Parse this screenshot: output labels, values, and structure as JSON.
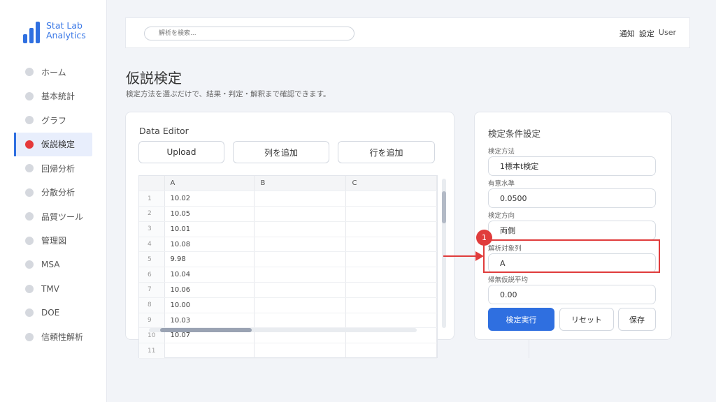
{
  "app": {
    "name": "Stat Lab Analytics"
  },
  "sidebar": {
    "items": [
      {
        "label": "ホーム"
      },
      {
        "label": "基本統計"
      },
      {
        "label": "グラフ"
      },
      {
        "label": "仮説検定",
        "active": true
      },
      {
        "label": "回帰分析"
      },
      {
        "label": "分散分析"
      },
      {
        "label": "品質ツール"
      },
      {
        "label": "管理図"
      },
      {
        "label": "MSA"
      },
      {
        "label": "TMV"
      },
      {
        "label": "DOE"
      },
      {
        "label": "信頼性解析"
      }
    ]
  },
  "topbar": {
    "search_placeholder": "解析を検索...",
    "notifications": "通知",
    "settings": "設定",
    "user": "User"
  },
  "page": {
    "title": "仮説検定",
    "subtitle": "検定方法を選ぶだけで、結果・判定・解釈まで確認できます。"
  },
  "editor": {
    "title": "Data Editor",
    "upload": "Upload",
    "add_column": "列を追加",
    "add_row": "行を追加",
    "columns": [
      "A",
      "B",
      "C"
    ],
    "rows": [
      {
        "n": "1",
        "a": "10.02"
      },
      {
        "n": "2",
        "a": "10.05"
      },
      {
        "n": "3",
        "a": "10.01"
      },
      {
        "n": "4",
        "a": "10.08"
      },
      {
        "n": "5",
        "a": "9.98"
      },
      {
        "n": "6",
        "a": "10.04"
      },
      {
        "n": "7",
        "a": "10.06"
      },
      {
        "n": "8",
        "a": "10.00"
      },
      {
        "n": "9",
        "a": "10.03"
      },
      {
        "n": "10",
        "a": "10.07"
      },
      {
        "n": "11",
        "a": ""
      }
    ]
  },
  "settings": {
    "title": "検定条件設定",
    "method_label": "検定方法",
    "method_value": "1標本t検定",
    "alpha_label": "有意水準",
    "alpha_value": "0.0500",
    "direction_label": "検定方向",
    "direction_value": "両側",
    "target_label": "解析対象列",
    "target_value": "A",
    "mean_label": "帰無仮説平均",
    "mean_value": "0.00",
    "run": "検定実行",
    "reset": "リセット",
    "save": "保存"
  },
  "annotation": {
    "step": "1",
    "color": "#e03c3c"
  },
  "colors": {
    "accent": "#2f6fe0",
    "active_dot": "#e5393a"
  }
}
